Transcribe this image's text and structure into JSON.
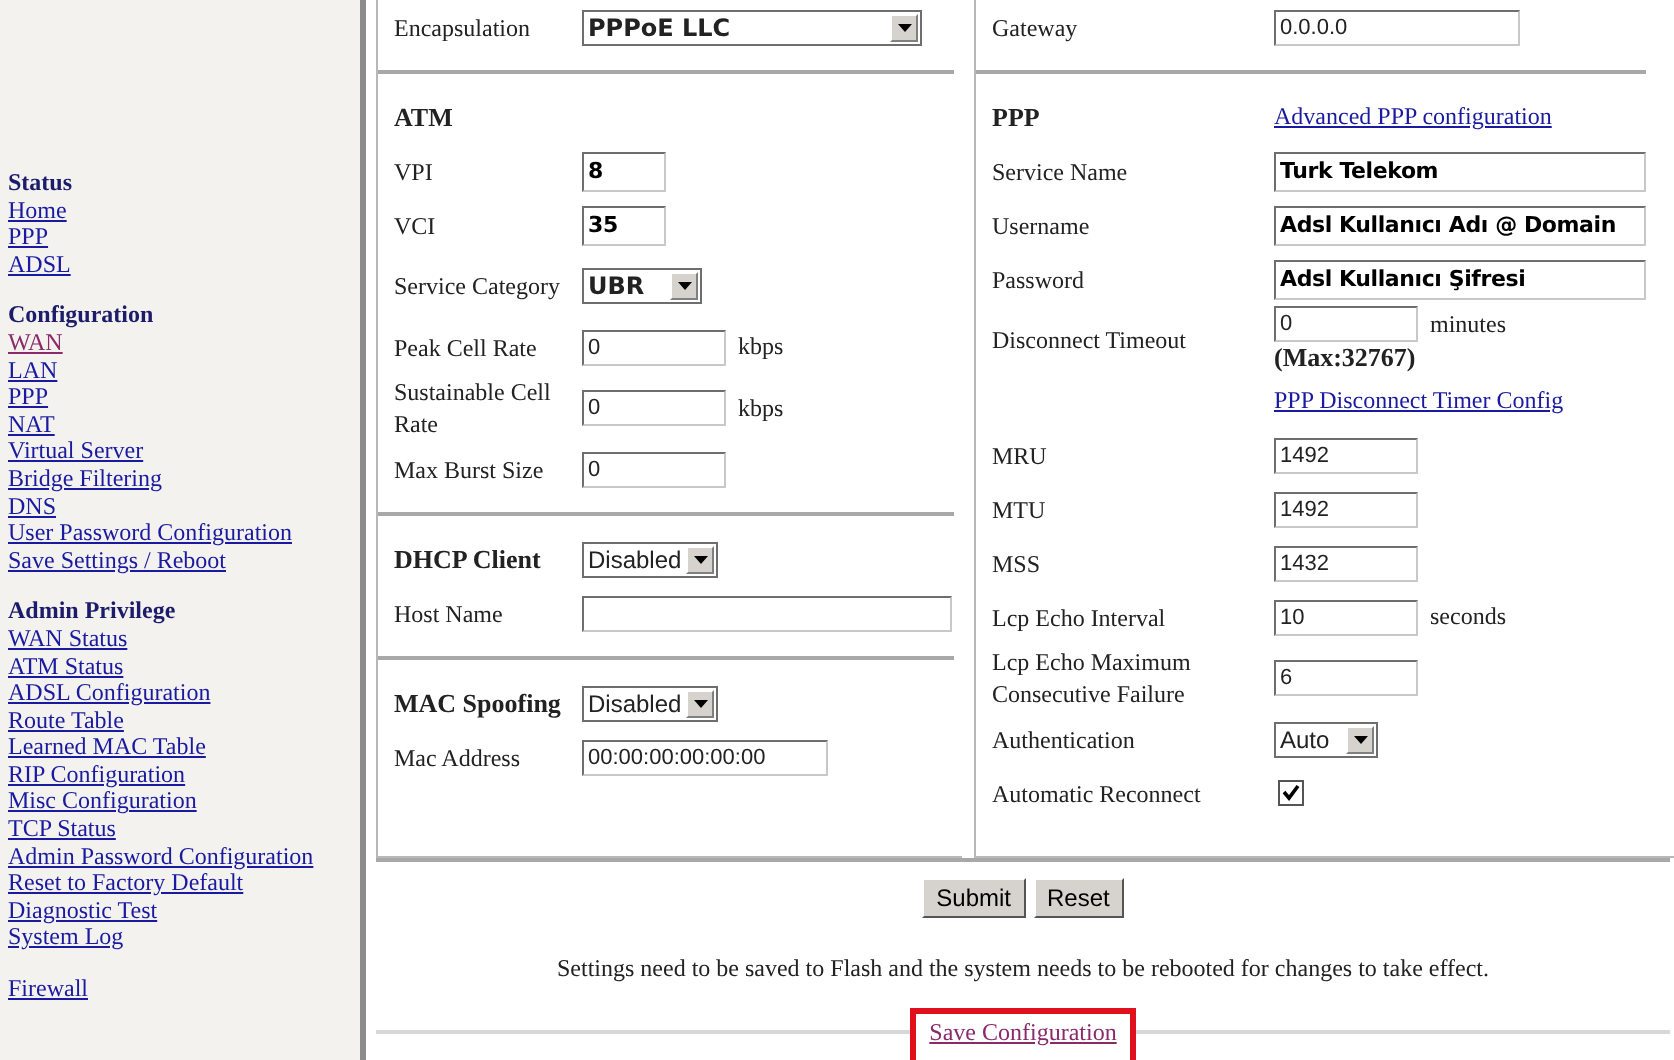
{
  "sidebar": {
    "groups": [
      {
        "heading": "Status",
        "items": [
          {
            "label": "Home",
            "visited": false
          },
          {
            "label": "PPP",
            "visited": false
          },
          {
            "label": "ADSL",
            "visited": false
          }
        ]
      },
      {
        "heading": "Configuration",
        "items": [
          {
            "label": "WAN",
            "visited": true
          },
          {
            "label": "LAN",
            "visited": false
          },
          {
            "label": "PPP",
            "visited": false
          },
          {
            "label": "NAT",
            "visited": false
          },
          {
            "label": "Virtual Server",
            "visited": false
          },
          {
            "label": "Bridge Filtering",
            "visited": false
          },
          {
            "label": "DNS",
            "visited": false
          },
          {
            "label": "User Password Configuration",
            "visited": false
          },
          {
            "label": "Save Settings / Reboot",
            "visited": false
          }
        ]
      },
      {
        "heading": "Admin Privilege",
        "items": [
          {
            "label": "WAN Status",
            "visited": false
          },
          {
            "label": "ATM Status",
            "visited": false
          },
          {
            "label": "ADSL Configuration",
            "visited": false
          },
          {
            "label": "Route Table",
            "visited": false
          },
          {
            "label": "Learned MAC Table",
            "visited": false
          },
          {
            "label": "RIP Configuration",
            "visited": false
          },
          {
            "label": "Misc Configuration",
            "visited": false
          },
          {
            "label": "TCP Status",
            "visited": false
          },
          {
            "label": "Admin Password Configuration",
            "visited": false
          },
          {
            "label": "Reset to Factory Default",
            "visited": false
          },
          {
            "label": "Diagnostic Test",
            "visited": false
          },
          {
            "label": "System Log",
            "visited": false
          }
        ]
      },
      {
        "items": [
          {
            "label": "Firewall",
            "visited": false
          }
        ]
      }
    ]
  },
  "left_panel": {
    "sections": [
      {
        "rows": [
          {
            "kind": "select",
            "label": "Encapsulation",
            "value": "PPPoE LLC",
            "emphasized": true
          }
        ]
      },
      {
        "heading": "ATM",
        "rows": [
          {
            "kind": "input",
            "label": "VPI",
            "value": "8",
            "emphasized": true
          },
          {
            "kind": "input",
            "label": "VCI",
            "value": "35",
            "emphasized": true
          },
          {
            "kind": "select",
            "label": "Service Category",
            "value": "UBR",
            "emphasized": true
          },
          {
            "kind": "input",
            "label": "Peak Cell Rate",
            "value": "0",
            "unit": "kbps"
          },
          {
            "kind": "input",
            "label": "Sustainable Cell Rate",
            "value": "0",
            "unit": "kbps"
          },
          {
            "kind": "input",
            "label": "Max Burst Size",
            "value": "0"
          }
        ]
      },
      {
        "rows": [
          {
            "kind": "select",
            "label": "DHCP Client",
            "value": "Disabled",
            "label_bold": true
          },
          {
            "kind": "input",
            "label": "Host Name"
          }
        ]
      },
      {
        "rows": [
          {
            "kind": "select",
            "label": "MAC Spoofing",
            "value": "Disabled",
            "label_bold": true
          },
          {
            "kind": "input",
            "label": "Mac Address",
            "value": "00:00:00:00:00:00"
          }
        ]
      }
    ]
  },
  "right_panel": {
    "sections": [
      {
        "rows": [
          {
            "kind": "input",
            "label": "Gateway",
            "value": "0.0.0.0"
          }
        ]
      },
      {
        "heading": "PPP",
        "heading_link": "Advanced PPP configuration",
        "rows": [
          {
            "kind": "input",
            "label": "Service Name",
            "value": "Turk Telekom",
            "emphasized": true
          },
          {
            "kind": "input",
            "label": "Username",
            "value": "Adsl Kullanıcı Adı @ Domain",
            "emphasized": true
          },
          {
            "kind": "input",
            "label": "Password",
            "value": "Adsl Kullanıcı Şifresi",
            "emphasized": true
          },
          {
            "kind": "input",
            "label": "Disconnect Timeout",
            "value": "0",
            "unit": "minutes",
            "note": "(Max:32767)"
          },
          {
            "kind": "link",
            "link": "PPP Disconnect Timer Config"
          },
          {
            "kind": "input",
            "label": "MRU",
            "value": "1492"
          },
          {
            "kind": "input",
            "label": "MTU",
            "value": "1492"
          },
          {
            "kind": "input",
            "label": "MSS",
            "value": "1432"
          },
          {
            "kind": "input",
            "label": "Lcp Echo Interval",
            "value": "10",
            "unit": "seconds"
          },
          {
            "kind": "input",
            "label": "Lcp Echo Maximum Consecutive Failure",
            "value": "6"
          },
          {
            "kind": "select",
            "label": "Authentication",
            "value": "Auto"
          },
          {
            "kind": "checkbox",
            "label": "Automatic Reconnect",
            "checked": true
          }
        ]
      }
    ]
  },
  "buttons": [
    "Submit",
    "Reset"
  ],
  "notice": "Settings need to be saved to Flash and the system needs to be rebooted for changes to take effect.",
  "save_link": {
    "label": "Save Configuration",
    "visited": true,
    "highlighted": true
  }
}
